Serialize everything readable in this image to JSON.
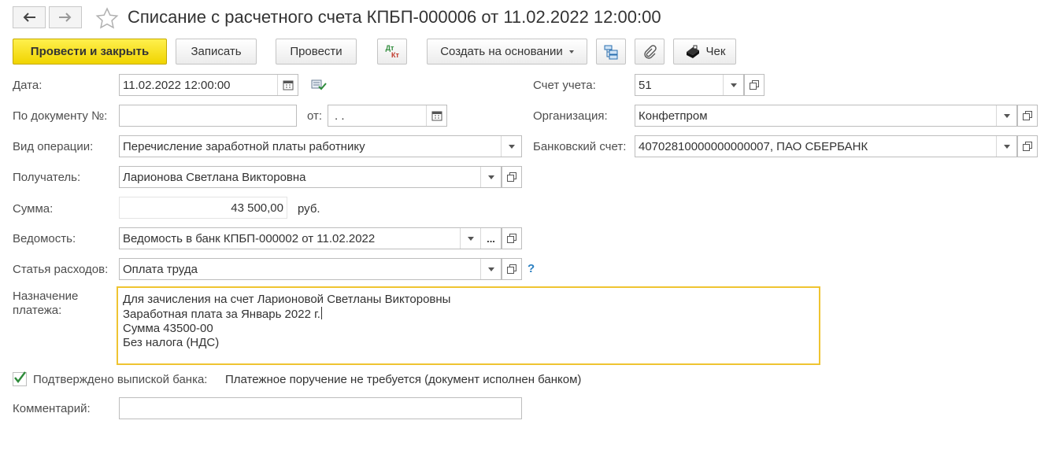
{
  "window": {
    "title": "Списание с расчетного счета КПБП-000006 от 11.02.2022 12:00:00"
  },
  "toolbar": {
    "post_and_close": "Провести и закрыть",
    "save": "Записать",
    "post": "Провести",
    "dt_label": "Дт",
    "kt_label": "Кт",
    "create_based_on": "Создать на основании",
    "receipt": "Чек"
  },
  "form": {
    "date": {
      "label": "Дата:",
      "value": "11.02.2022 12:00:00"
    },
    "doc_number": {
      "label": "По документу №:",
      "value": ""
    },
    "doc_date": {
      "label": "от:",
      "value": " .  ."
    },
    "operation_type": {
      "label": "Вид операции:",
      "value": "Перечисление заработной платы работнику"
    },
    "recipient": {
      "label": "Получатель:",
      "value": "Ларионова Светлана Викторовна"
    },
    "amount": {
      "label": "Сумма:",
      "value": "43 500,00",
      "currency": "руб."
    },
    "statement": {
      "label": "Ведомость:",
      "value": "Ведомость в банк КПБП-000002 от 11.02.2022"
    },
    "expense_item": {
      "label": "Статья расходов:",
      "value": "Оплата труда",
      "help": "?"
    },
    "account": {
      "label": "Счет учета:",
      "value": "51"
    },
    "organization": {
      "label": "Организация:",
      "value": "Конфетпром"
    },
    "bank_account": {
      "label": "Банковский счет:",
      "value": "40702810000000000007, ПАО СБЕРБАНК"
    },
    "purpose": {
      "label_line1": "Назначение",
      "label_line2": "платежа:",
      "lines": [
        "Для зачисления на счет Ларионовой Светланы Викторовны",
        "Заработная плата за Январь 2022 г.",
        "Сумма 43500-00",
        "Без налога (НДС)"
      ]
    },
    "confirmed": {
      "label": "Подтверждено выпиской банка:",
      "checked": true,
      "note": "Платежное поручение не требуется (документ исполнен банком)"
    },
    "comment": {
      "label": "Комментарий:",
      "value": ""
    }
  },
  "colors": {
    "primary_button": "#f5dc1e",
    "focus_border": "#efc431",
    "check": "#2e8b3a",
    "help": "#2a7fc1"
  }
}
